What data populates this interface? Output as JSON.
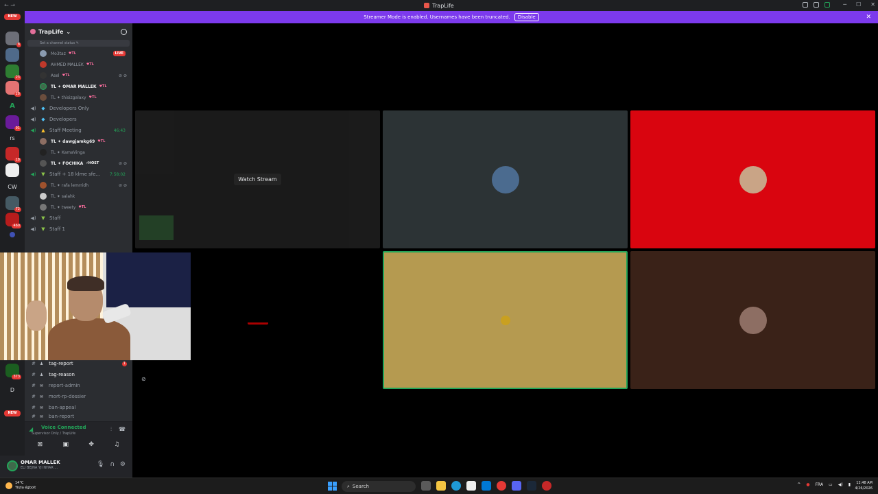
{
  "titlebar": {
    "nav": "← →",
    "title": "TrapLife"
  },
  "banner": {
    "text": "Streamer Mode is enabled. Usernames have been truncated.",
    "button": "Disable",
    "close": "✕"
  },
  "rail": {
    "new_top": "NEW",
    "new_bottom": "NEW",
    "servers": [
      {
        "badge": "8"
      },
      {
        "badge": ""
      },
      {
        "badge": "23"
      },
      {
        "badge": "28"
      },
      {
        "text": "A"
      },
      {
        "badge": "91"
      },
      {
        "text": "rs"
      },
      {
        "badge": "18"
      },
      {
        "badge": ""
      },
      {
        "text": "CW"
      },
      {
        "badge": "72"
      },
      {
        "badge": "460"
      },
      {
        "badge": ""
      },
      {
        "badge": "373"
      },
      {
        "text": "D"
      }
    ]
  },
  "guild": {
    "name": "TrapLife",
    "status_placeholder": "Set a channel status ✎"
  },
  "top_users": [
    {
      "name": "Mo3taz",
      "tag": "♥TL",
      "live": "LIVE",
      "color": "#8a9bb0"
    },
    {
      "name": "AHMED MALLEK",
      "tag": "♥TL",
      "color": "#c0392b"
    },
    {
      "name": "Asel",
      "tag": "♥TL",
      "color": "#333"
    },
    {
      "name": "TL ✦ OMAR MALLEK",
      "tag": "♥TL",
      "color": "#3f6a4b",
      "highlight": true
    },
    {
      "name": "TL ✦ thisizgalaxy",
      "tag": "♥TL",
      "color": "#6b4e3d"
    }
  ],
  "voice_channels": {
    "dev_only": "Developers Only",
    "developers": "Developers",
    "staff_meeting": "Staff Meeting",
    "staff_meeting_timer": "46:43",
    "staff_meeting_users": [
      {
        "name": "TL ✦ dawgjamkg69",
        "tag": "♥TL",
        "color": "#8d6e63",
        "highlight": true
      },
      {
        "name": "TL ✦ KamaVinga",
        "tag": "",
        "color": "#222"
      },
      {
        "name": "TL ✦ FOCHIKA",
        "tag": "⚡HOST",
        "color": "#555",
        "highlight": true
      }
    ],
    "staff18": "Staff + 18 klme sfe...",
    "staff18_timer": "7:58:02",
    "staff18_users": [
      {
        "name": "TL ✦ rafa lemrridh",
        "color": "#a0522d"
      },
      {
        "name": "TL ✦ salahk",
        "color": "#ccc"
      },
      {
        "name": "TL ✦ tweety",
        "tag": "♥TL",
        "color": "#777"
      }
    ],
    "staff": "Staff",
    "staff1": "Staff 1"
  },
  "text_channels": [
    {
      "name": "tag-report",
      "highlight": true,
      "unread": "1"
    },
    {
      "name": "tag-reason",
      "highlight": true
    },
    {
      "name": "report-admin"
    },
    {
      "name": "mort-rp-dossier"
    },
    {
      "name": "ban-appeal"
    },
    {
      "name": "ban-report"
    }
  ],
  "voice_bar": {
    "status": "Voice Connected",
    "sub": "Supervisor Only / TrapLife"
  },
  "user": {
    "name": "OMAR MALLEK",
    "sub": "ELI BEJNA YJI NHAR ..."
  },
  "stage": {
    "watch_label": "Watch Stream",
    "tiles": [
      {
        "bg": "#2c3335",
        "avatar": "#4b6b8f"
      },
      {
        "bg": "#d9050f",
        "avatar": "#c9a486"
      },
      {
        "bg": "#000000",
        "avatar": "#a00"
      },
      {
        "bg": "#b59a50",
        "avatar": "#c9a020"
      },
      {
        "bg": "#3a2218",
        "avatar": "#8d6e63"
      }
    ]
  },
  "taskbar": {
    "temp": "14°C",
    "weather": "Tiizla égbolt",
    "search": "Search",
    "lang": "FRA",
    "time": "12:48 AM",
    "date": "4/26/2026"
  }
}
